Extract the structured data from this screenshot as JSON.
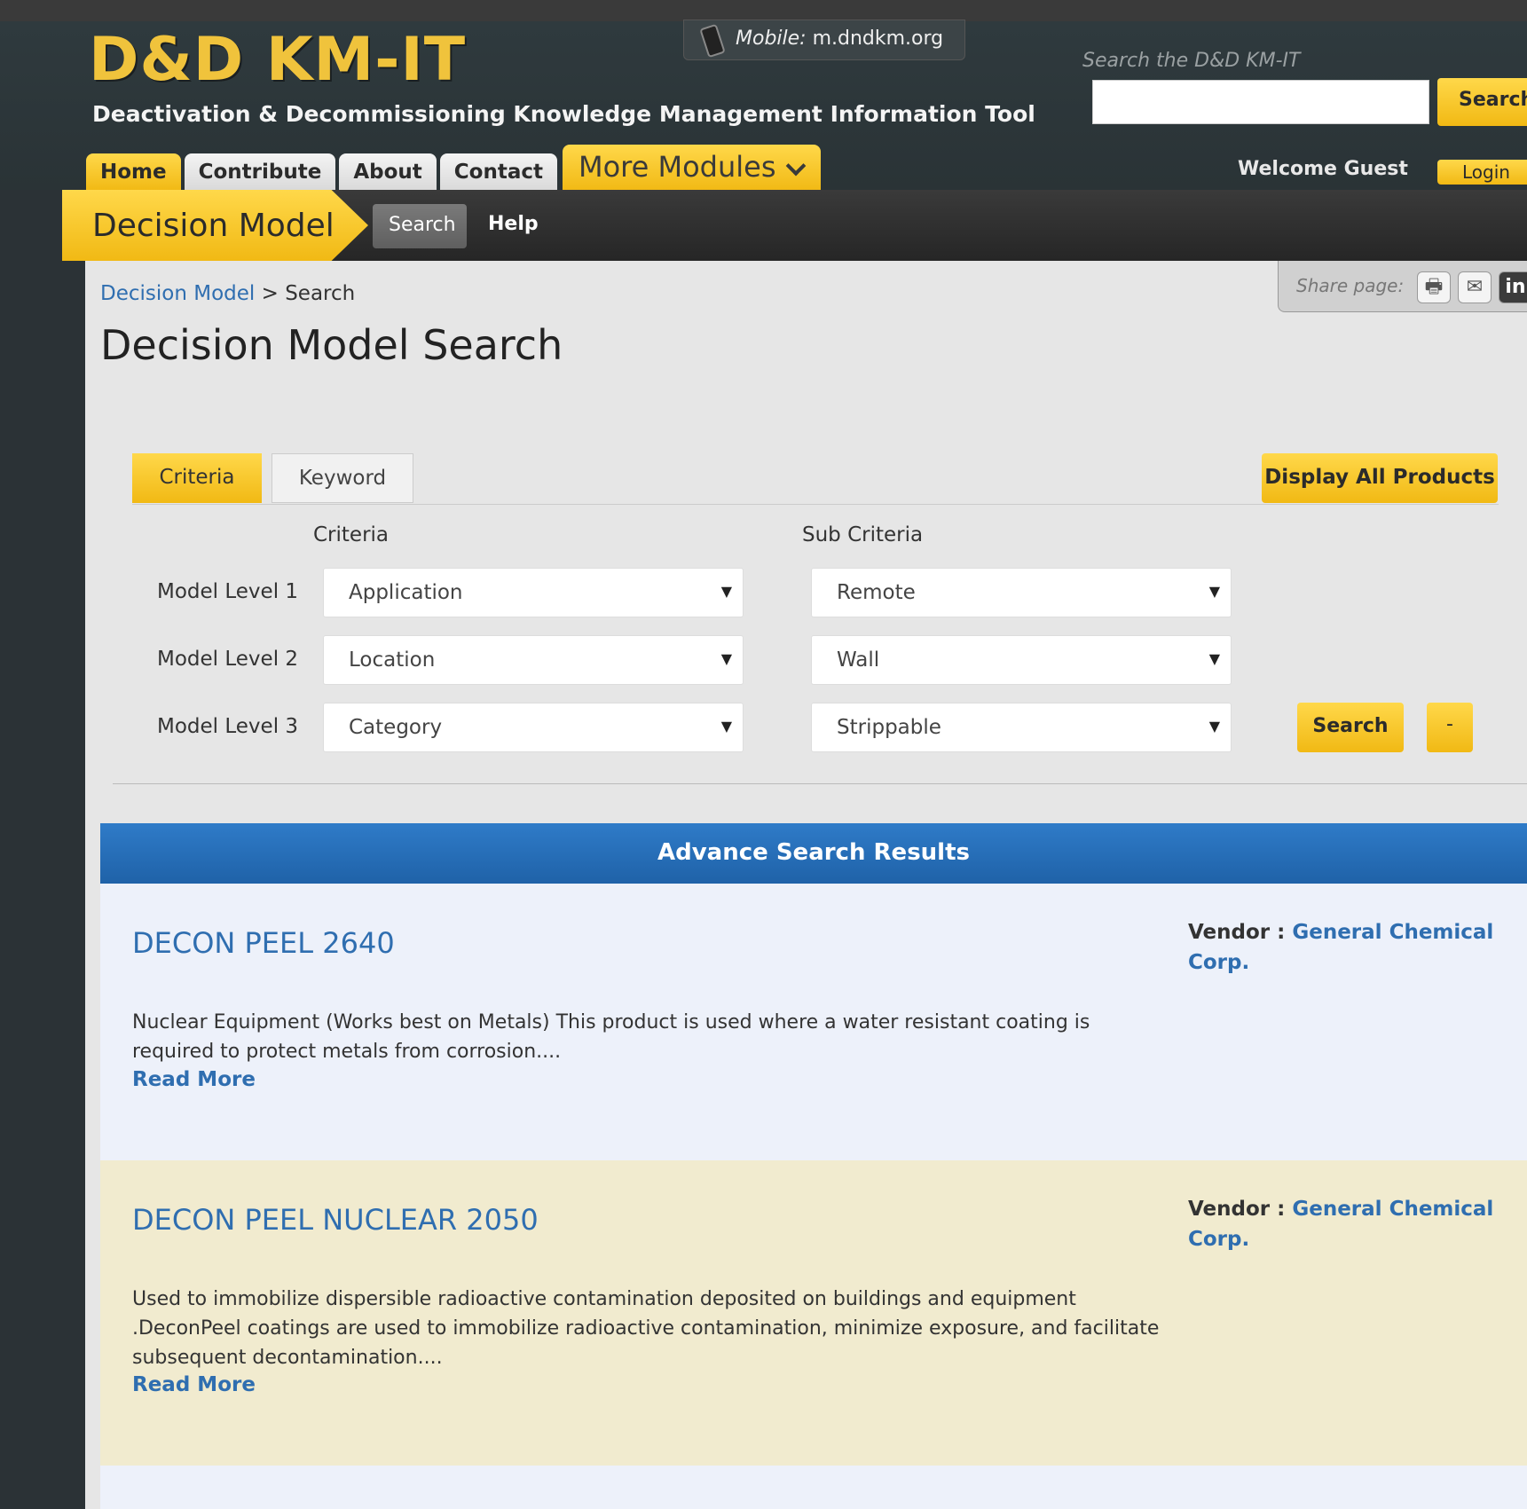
{
  "header": {
    "logo": "D&D KM-IT",
    "tagline": "Deactivation & Decommissioning Knowledge Management Information Tool",
    "mobile_label": "Mobile:",
    "mobile_url": "m.dndkm.org",
    "search_label": "Search the D&D KM-IT",
    "search_value": "",
    "search_button": "Search",
    "welcome": "Welcome Guest",
    "login": "Login"
  },
  "nav": {
    "home": "Home",
    "contribute": "Contribute",
    "about": "About",
    "contact": "Contact",
    "more": "More Modules"
  },
  "module_bar": {
    "title": "Decision Model",
    "search": "Search",
    "help": "Help"
  },
  "share": {
    "label": "Share page:",
    "print": "🖶",
    "email": "✉",
    "linkedin": "in"
  },
  "breadcrumb": {
    "root": "Decision Model",
    "sep": ">",
    "current": "Search"
  },
  "page_title": "Decision Model Search",
  "tabs": {
    "criteria": "Criteria",
    "keyword": "Keyword"
  },
  "display_all": "Display All Products",
  "form": {
    "criteria_head": "Criteria",
    "sub_head": "Sub Criteria",
    "rows": [
      {
        "label": "Model Level 1",
        "criteria": "Application",
        "sub": "Remote"
      },
      {
        "label": "Model Level 2",
        "criteria": "Location",
        "sub": "Wall"
      },
      {
        "label": "Model Level 3",
        "criteria": "Category",
        "sub": "Strippable"
      }
    ],
    "arrow": "▼",
    "search": "Search",
    "minus": "-"
  },
  "results": {
    "title": "Advance Search Results",
    "vendor_label": "Vendor :",
    "items": [
      {
        "name": "DECON PEEL 2640",
        "vendor": "General Chemical Corp.",
        "desc": "Nuclear Equipment (Works best on Metals) This product is used where a water resistant coating is required to protect metals from corrosion....",
        "more": "Read More"
      },
      {
        "name": "DECON PEEL NUCLEAR 2050",
        "vendor": "General Chemical Corp.",
        "desc": "Used to immobilize dispersible radioactive contamination deposited on buildings and equipment .DeconPeel coatings are used to immobilize radioactive contamination, minimize exposure, and facilitate subsequent decontamination....",
        "more": "Read More"
      }
    ]
  }
}
